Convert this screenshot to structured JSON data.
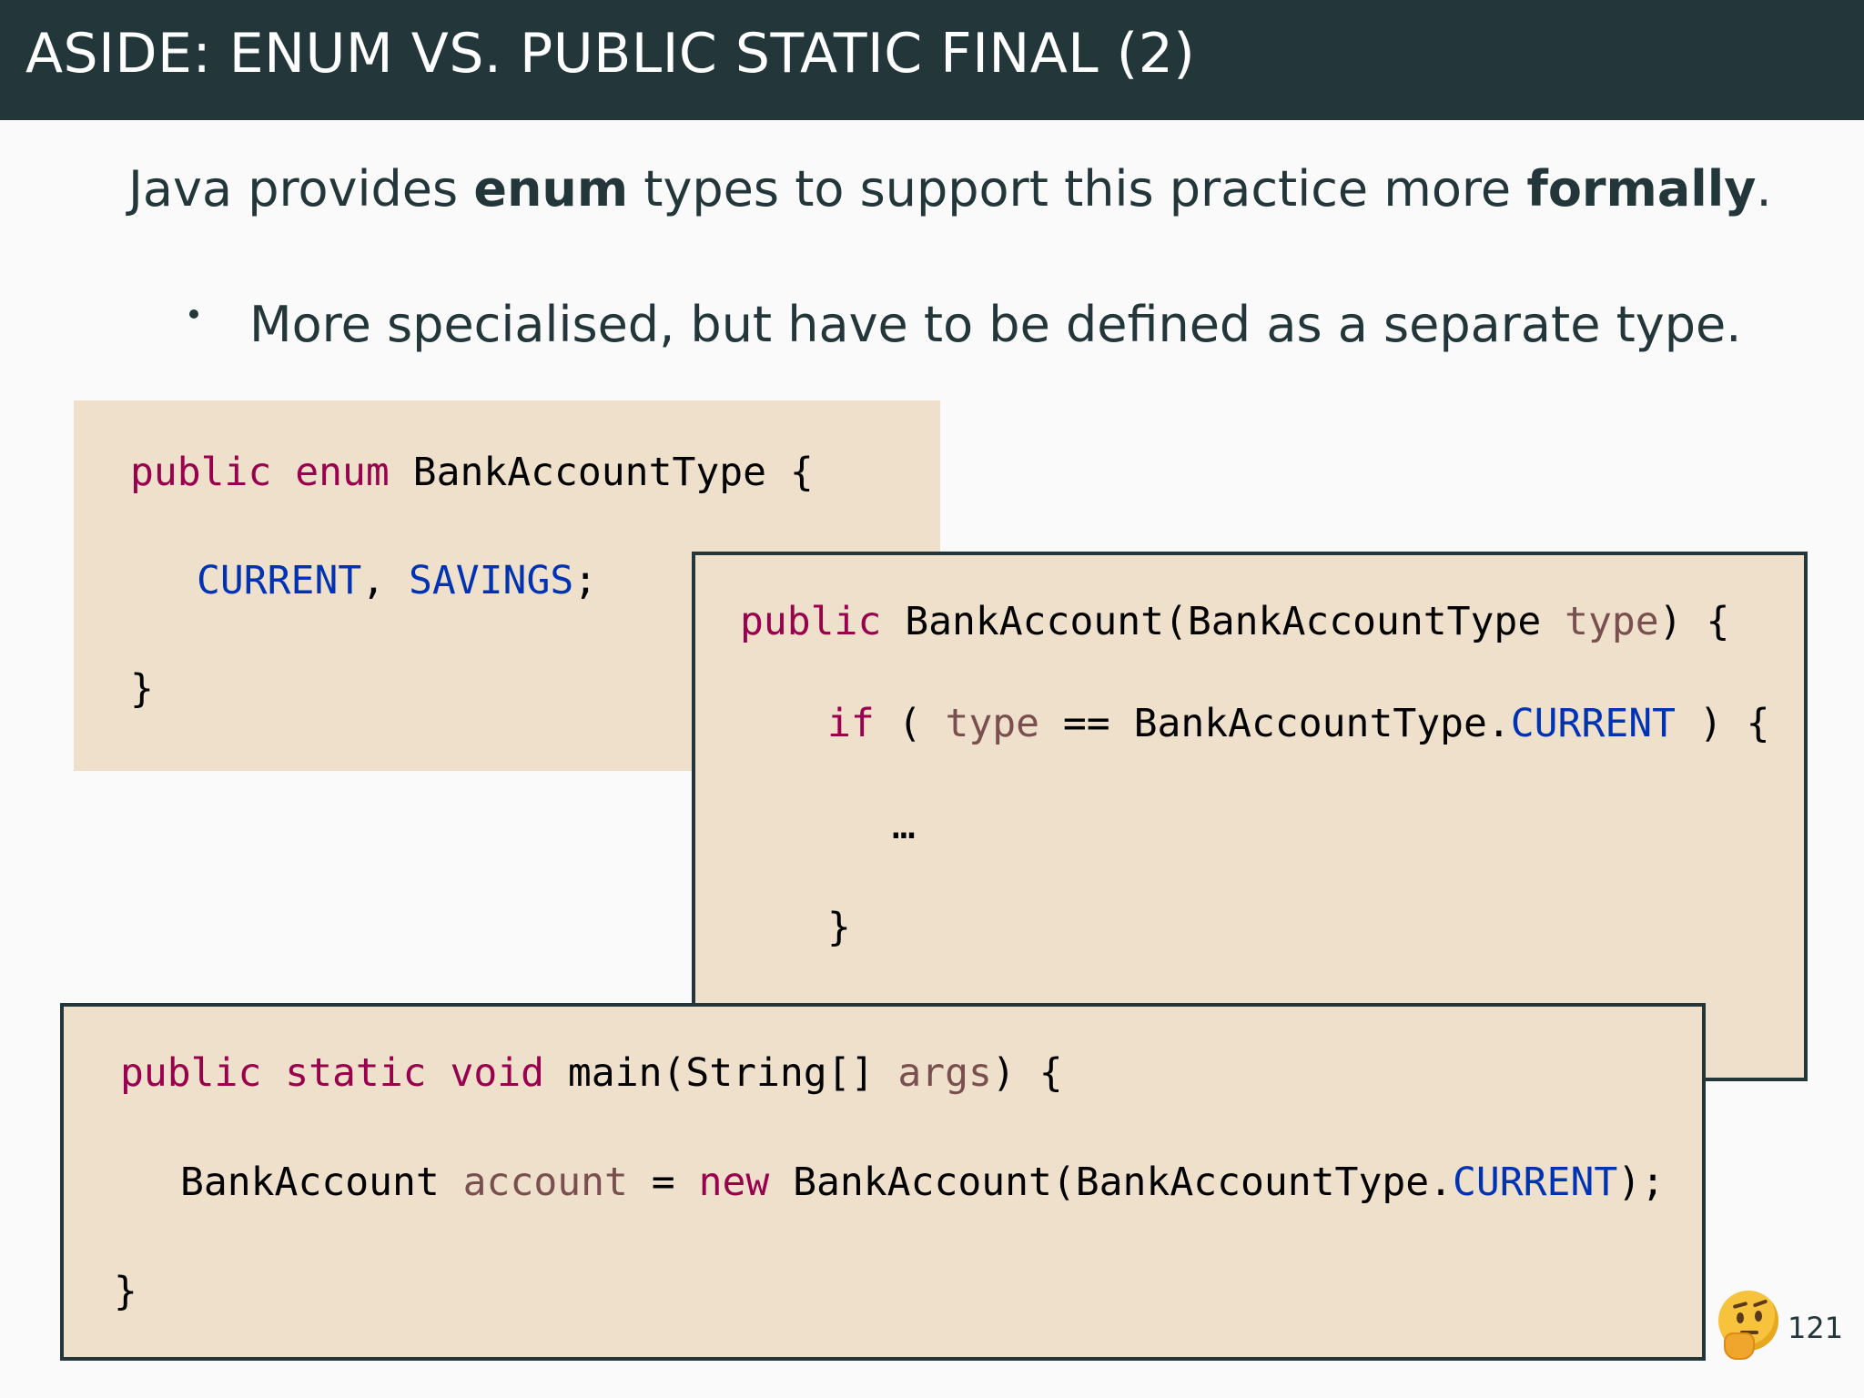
{
  "slide": {
    "title": "ASIDE: ENUM VS. PUBLIC STATIC FINAL (2)",
    "lead_text": "Java provides enum types to support this practice more formally.",
    "lead_parts": [
      "Java provides ",
      "enum",
      " types to support this practice more ",
      "formally",
      "."
    ],
    "bullet": "More specialised, but have to be defined as a separate type.",
    "page_number": "121",
    "emoji_icon": "thinking-face"
  },
  "code": {
    "enum_box": [
      [
        "public",
        " ",
        "enum",
        " BankAccountType {"
      ],
      [
        "CURRENT",
        ", ",
        "SAVINGS",
        ";"
      ],
      [
        "}"
      ]
    ],
    "ctor_box": [
      [
        "public",
        " BankAccount(BankAccountType ",
        "type",
        ") {"
      ],
      [
        "if",
        " ( ",
        "type",
        " == BankAccountType.",
        "CURRENT",
        " ) {"
      ],
      [
        "…"
      ],
      [
        "}"
      ]
    ],
    "main_box": [
      [
        "public",
        " ",
        "static",
        " ",
        "void",
        " main(String[] ",
        "args",
        ") {"
      ],
      [
        "BankAccount ",
        "account",
        " = ",
        "new",
        " BankAccount(BankAccountType.",
        "CURRENT",
        ");"
      ],
      [
        "}"
      ]
    ]
  },
  "colors": {
    "title_bar": "#23373b",
    "code_background": "#eee0cb",
    "keyword": "#99004d",
    "constant": "#0033b3",
    "variable": "#7a4f4f"
  }
}
